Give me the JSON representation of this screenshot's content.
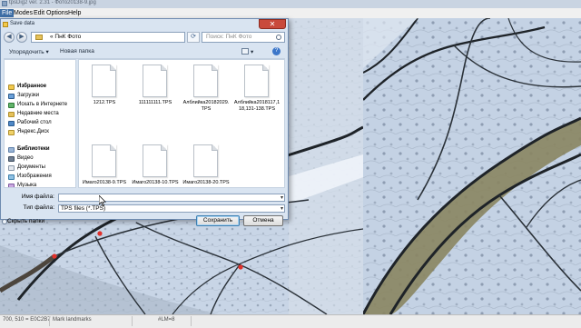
{
  "app": {
    "title": "tpsDig2 ver. 2.31 - Фото20138-9.jpg",
    "menu": [
      "File",
      "Modes",
      "Edit",
      "Options",
      "Help"
    ]
  },
  "status": {
    "coords": "700, 510 = E0C2B7",
    "mode": "Mark landmarks",
    "lm": "#LM=8"
  },
  "dialog": {
    "title": "Save data",
    "close_glyph": "✕",
    "back_glyph": "◀",
    "forward_glyph": "▶",
    "refresh_glyph": "⟳",
    "address": "« ПнК Фото",
    "search_placeholder": "Поиск: ПнК Фото",
    "toolbar": {
      "organize": "Упорядочить ▾",
      "new_folder": "Новая папка",
      "view": "▾"
    },
    "nav": {
      "favorites_header": "Избранное",
      "favorites": [
        "Загрузки",
        "Искать в Интернете",
        "Недавние места",
        "Рабочий стол",
        "Яндекс.Диск"
      ],
      "libraries_header": "Библиотеки",
      "libraries": [
        "Видео",
        "Документы",
        "Изображения",
        "Музыка"
      ]
    },
    "files": [
      "1212.TPS",
      "111111111.TPS",
      "Алблийка20182029.TPS",
      "Алблийка2018117,118,131-138.TPS",
      "Имаго20138-9.TPS",
      "Имаго20138-10.TPS",
      "Имаго20138-20.TPS"
    ],
    "filename_label": "Имя файла:",
    "filename_value": "",
    "filetype_label": "Тип файла:",
    "filetype_value": "TPS files (*.TPS)",
    "hide_folders": "Скрыть папки",
    "save_button": "Сохранить",
    "cancel_button": "Отмена",
    "help_glyph": "?"
  },
  "colors": {
    "landmark": "#e0302a",
    "vein": "#1e2328",
    "membrane": "#c4d2e4"
  },
  "icons": {
    "back": "back-arrow-icon",
    "forward": "forward-arrow-icon",
    "refresh": "refresh-icon",
    "search": "search-icon",
    "help": "help-icon",
    "view": "view-options-icon"
  }
}
